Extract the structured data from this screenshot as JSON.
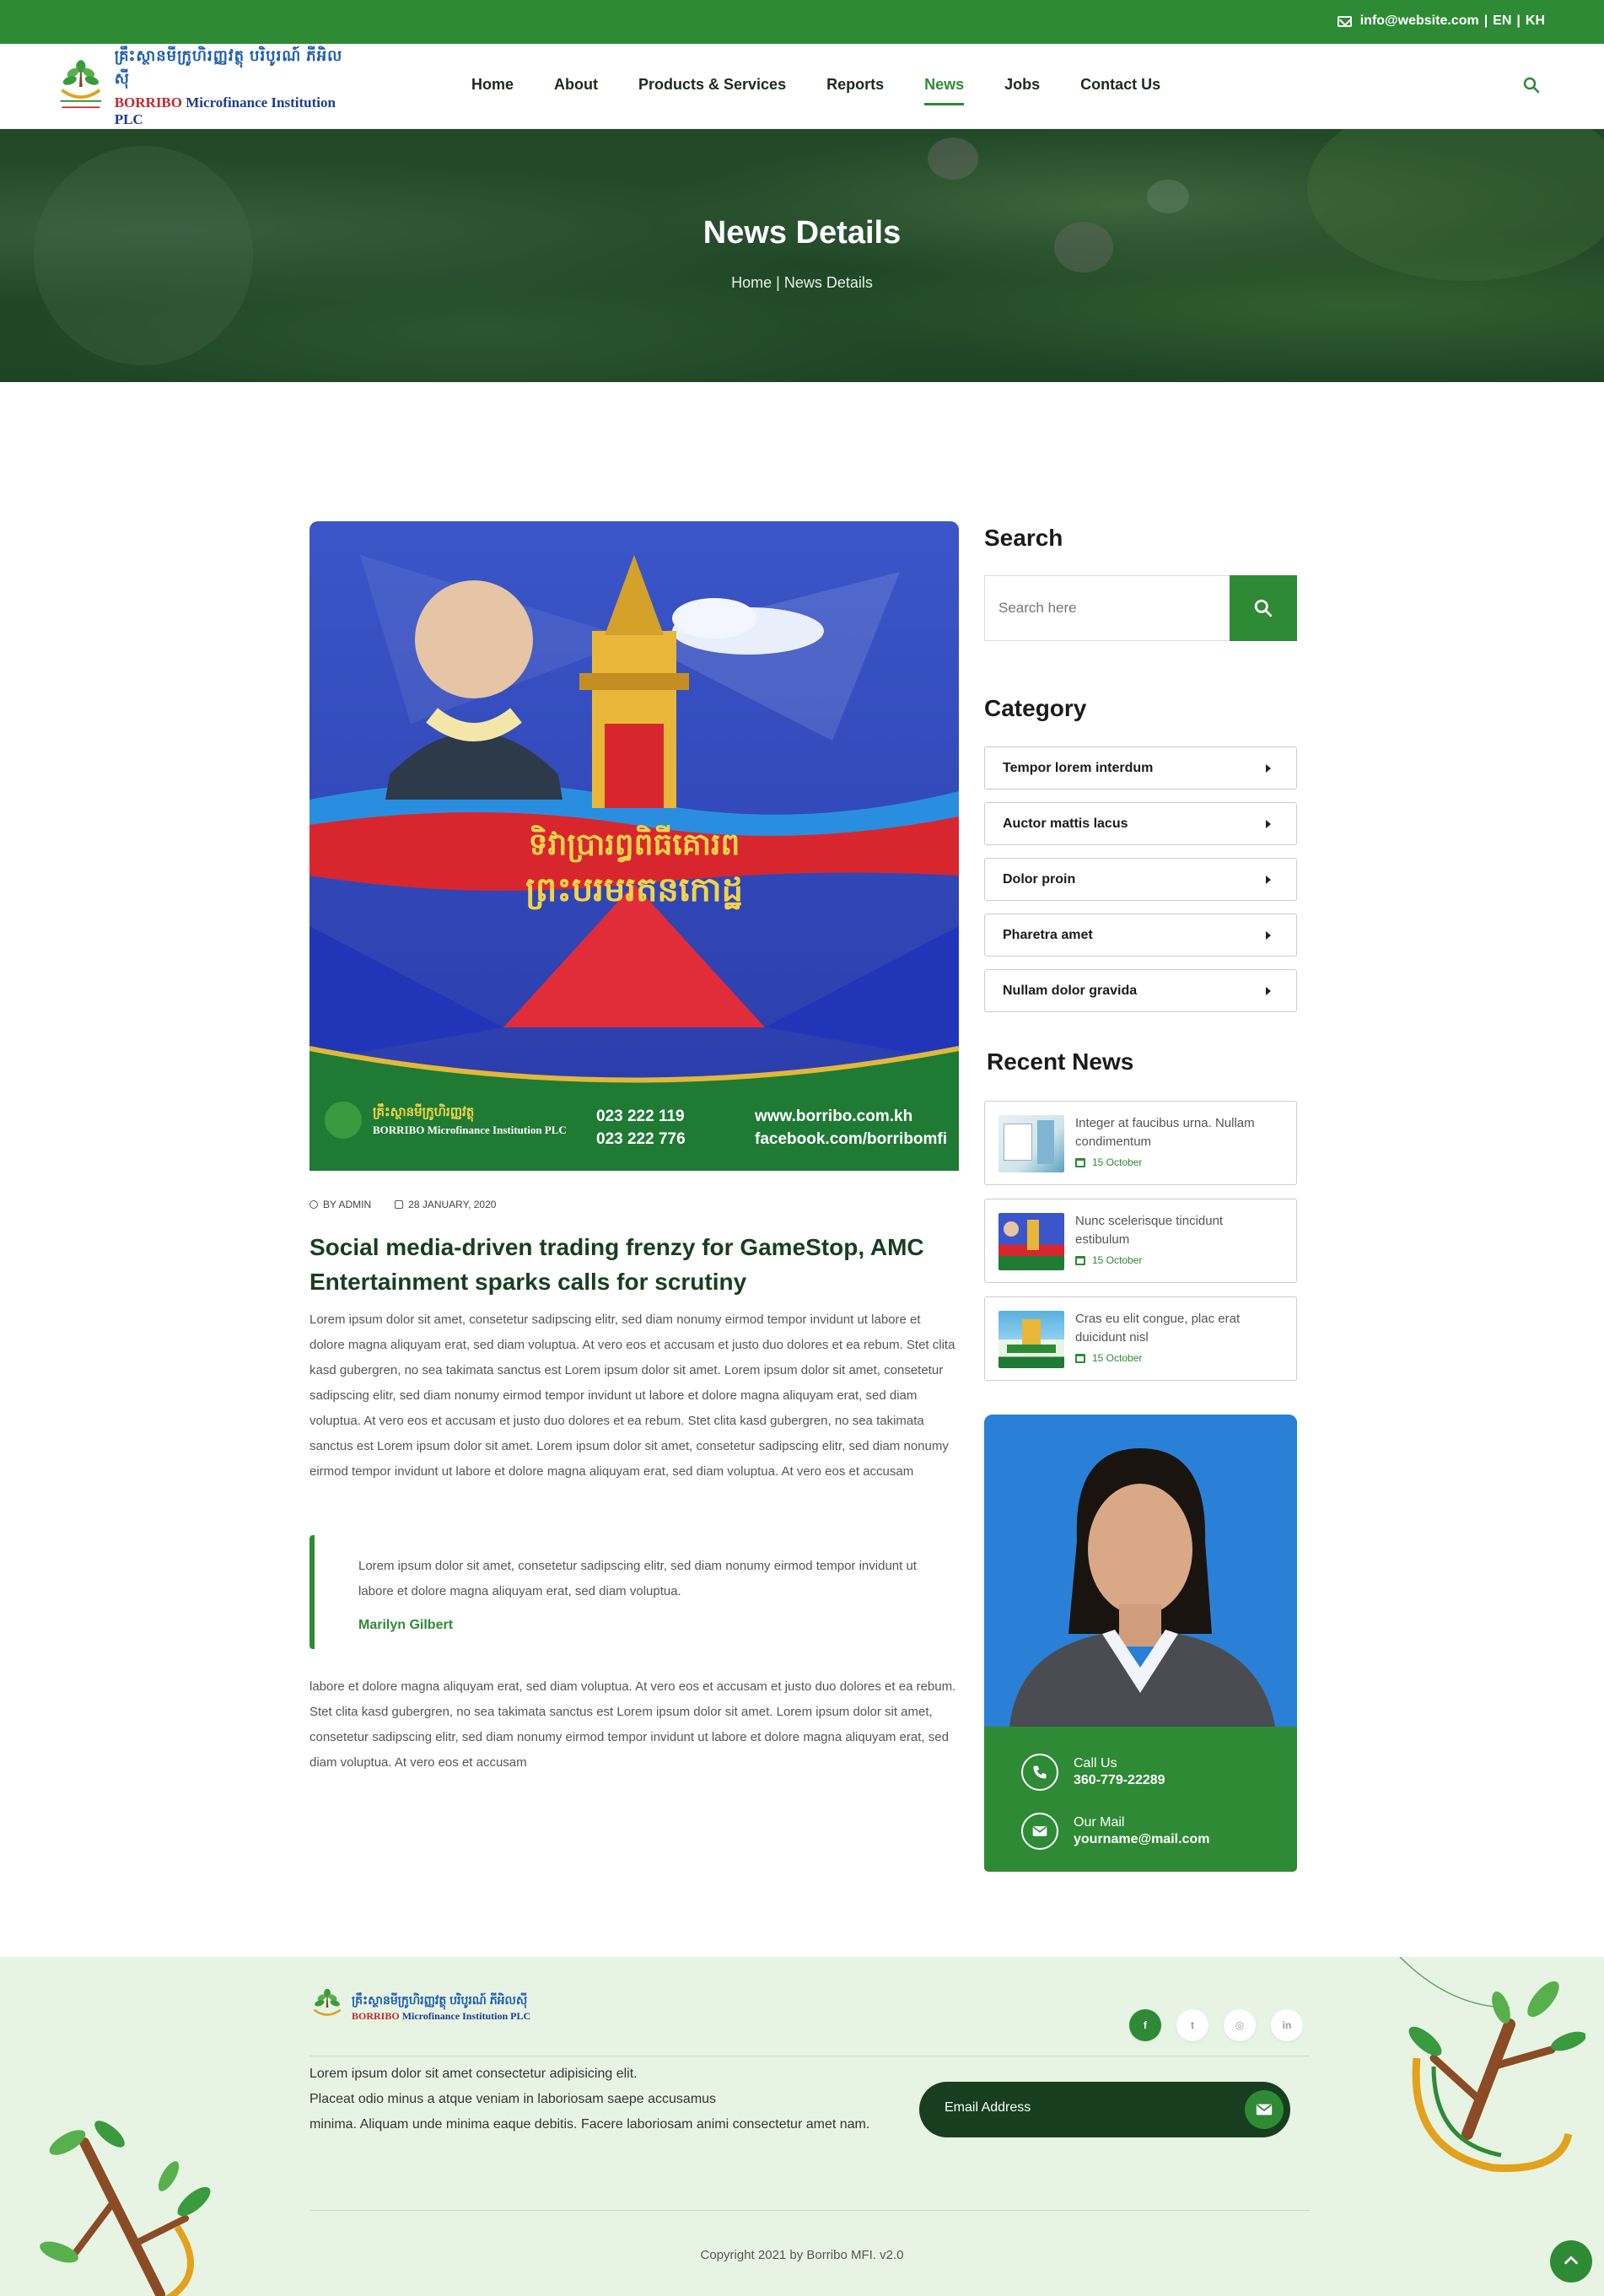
{
  "topbar": {
    "email": "info@website.com",
    "lang_en": "EN",
    "lang_kh": "KH",
    "sep": "|"
  },
  "header": {
    "logo_kh": "គ្រឹះស្ថានមីក្រូហិរញ្ញវត្ថុ បរិបូរណ៍ ភីអិលស៊ី",
    "logo_brand": "BORRIBO",
    "logo_en": "Microfinance Institution PLC",
    "nav": [
      {
        "label": "Home"
      },
      {
        "label": "About"
      },
      {
        "label": "Products & Services"
      },
      {
        "label": "Reports"
      },
      {
        "label": "News"
      },
      {
        "label": "Jobs"
      },
      {
        "label": "Contact Us"
      }
    ],
    "active_nav": "News",
    "search_icon": "search-icon"
  },
  "hero": {
    "title": "News Details",
    "breadcrumb": "Home | News Details"
  },
  "article": {
    "image_caption_phone1": "023 222 119",
    "image_caption_phone2": "023 222 776",
    "image_caption_web": "www.borribo.com.kh",
    "image_caption_fb": "facebook.com/borribomfi",
    "author": "BY ADMIN",
    "date": "28 JANUARY, 2020",
    "title": "Social media-driven trading frenzy for GameStop, AMC Entertainment sparks calls for scrutiny",
    "para1": "Lorem ipsum dolor sit amet, consetetur sadipscing elitr, sed diam nonumy eirmod tempor invidunt ut labore et dolore magna aliquyam erat, sed diam voluptua. At vero eos et accusam et justo duo dolores et ea rebum. Stet clita kasd gubergren, no sea takimata sanctus est Lorem ipsum dolor sit amet. Lorem ipsum dolor sit amet, consetetur sadipscing elitr, sed diam nonumy eirmod tempor invidunt ut labore et dolore magna aliquyam erat, sed diam voluptua. At vero eos et accusam et justo duo dolores et ea rebum. Stet clita kasd gubergren, no sea takimata sanctus est Lorem ipsum dolor sit amet. Lorem ipsum dolor sit amet, consetetur sadipscing elitr, sed diam nonumy eirmod tempor invidunt ut labore et dolore magna aliquyam erat, sed diam voluptua. At vero eos et accusam",
    "quote": "Lorem ipsum dolor sit amet, consetetur sadipscing elitr, sed diam nonumy eirmod tempor invidunt ut labore et dolore magna aliquyam erat, sed diam voluptua.",
    "quote_author": "Marilyn Gilbert",
    "para2": "labore et dolore magna aliquyam erat, sed diam voluptua. At vero eos et accusam et justo duo dolores et ea rebum. Stet clita kasd gubergren, no sea takimata sanctus est Lorem ipsum dolor sit amet. Lorem ipsum dolor sit amet, consetetur sadipscing elitr, sed diam nonumy eirmod tempor invidunt ut labore et dolore magna aliquyam erat, sed diam voluptua. At vero eos et accusam"
  },
  "sidebar": {
    "search_heading": "Search",
    "search_placeholder": "Search here",
    "category_heading": "Category",
    "categories": [
      {
        "label": "Tempor lorem interdum"
      },
      {
        "label": "Auctor mattis lacus"
      },
      {
        "label": "Dolor proin"
      },
      {
        "label": "Pharetra amet"
      },
      {
        "label": "Nullam dolor gravida"
      }
    ],
    "recent_heading": "Recent News",
    "recent": [
      {
        "title": "Integer at faucibus urna. Nullam condimentum",
        "date": "15 October"
      },
      {
        "title": "Nunc scelerisque tincidunt estibulum",
        "date": "15 October"
      },
      {
        "title": "Cras eu elit congue, plac erat duicidunt nisl",
        "date": "15 October"
      }
    ],
    "call_label": "Call Us",
    "call_value": "360-779-22289",
    "mail_label": "Our Mail",
    "mail_value": "yourname@mail.com"
  },
  "footer": {
    "logo_kh": "គ្រឹះស្ថានមីក្រូហិរញ្ញវត្ថុ បរិបូរណ៍ ភីអិលស៊ី",
    "logo_brand": "BORRIBO",
    "logo_en": "Microfinance Institution PLC",
    "desc_line1": "Lorem ipsum dolor sit amet consectetur adipisicing elit.",
    "desc_line2": "Placeat odio minus a atque veniam in laboriosam saepe accusamus",
    "desc_line3": "minima. Aliquam unde minima eaque debitis. Facere laboriosam animi consectetur amet nam.",
    "email_placeholder": "Email Address",
    "socials": [
      {
        "icon": "facebook-icon",
        "glyph": "f"
      },
      {
        "icon": "twitter-icon",
        "glyph": "t"
      },
      {
        "icon": "instagram-icon",
        "glyph": "◎"
      },
      {
        "icon": "linkedin-icon",
        "glyph": "in"
      }
    ],
    "copyright": "Copyright 2021 by Borribo MFI. v2.0"
  },
  "colors": {
    "brand_green": "#2f8a35",
    "dark_green": "#173f1f",
    "footer_bg": "#e7f4e4"
  }
}
